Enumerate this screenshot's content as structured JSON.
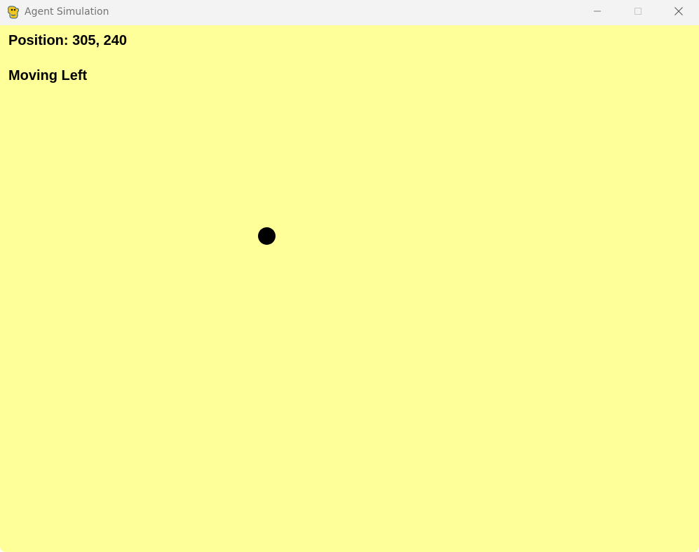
{
  "window": {
    "title": "Agent Simulation",
    "icon": "pygame-snake-icon",
    "controls": {
      "minimize": "minimize-icon",
      "maximize": "maximize-icon",
      "close": "close-icon"
    }
  },
  "hud": {
    "position_text": "Position: 305, 240",
    "status_text": "Moving Left"
  },
  "colors": {
    "canvas_background": "#ffff99",
    "agent": "#000000",
    "text": "#000000",
    "titlebar": "#f3f3f3"
  }
}
